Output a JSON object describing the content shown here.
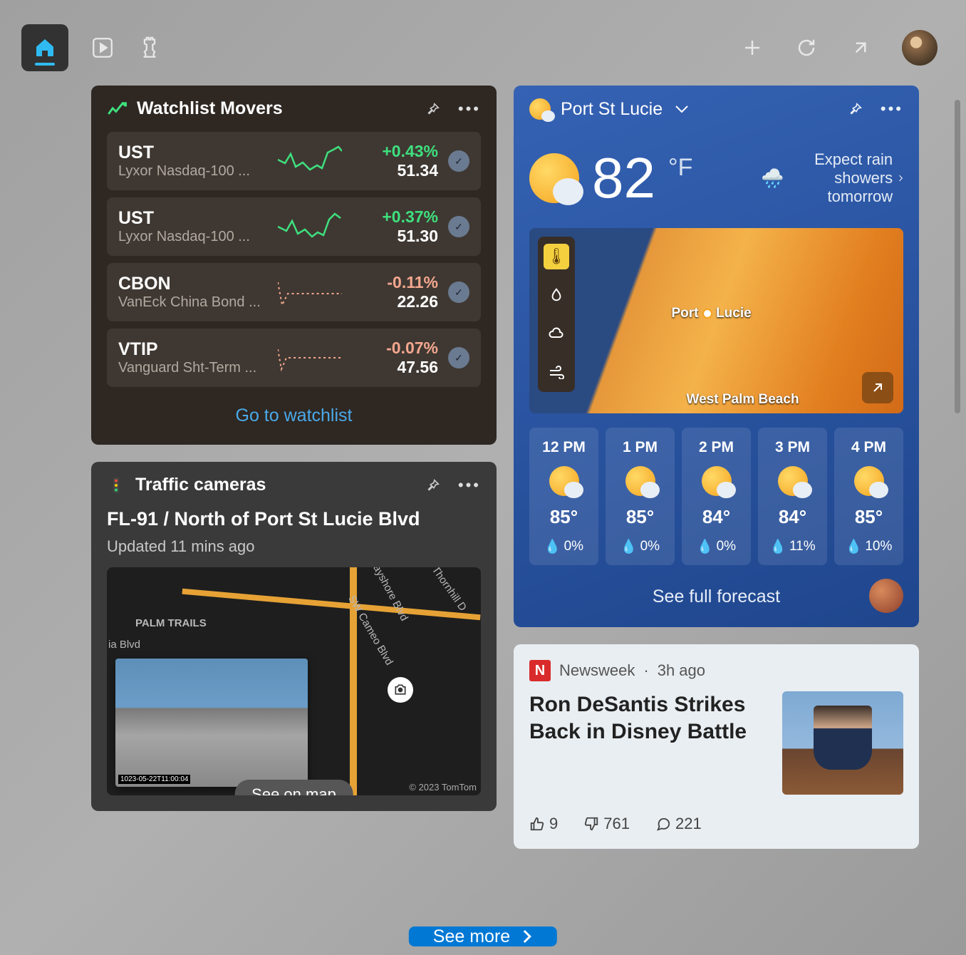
{
  "toolbar": {
    "home_icon": "home-icon",
    "play_icon": "play-icon",
    "chess_icon": "games-icon",
    "add_icon": "add-icon",
    "refresh_icon": "refresh-icon",
    "expand_icon": "expand-icon"
  },
  "watchlist": {
    "title": "Watchlist Movers",
    "footer": "Go to watchlist",
    "stocks": [
      {
        "ticker": "UST",
        "name": "Lyxor Nasdaq-100 ...",
        "change": "+0.43%",
        "price": "51.34",
        "dir": "pos"
      },
      {
        "ticker": "UST",
        "name": "Lyxor Nasdaq-100 ...",
        "change": "+0.37%",
        "price": "51.30",
        "dir": "pos"
      },
      {
        "ticker": "CBON",
        "name": "VanEck China Bond ...",
        "change": "-0.11%",
        "price": "22.26",
        "dir": "neg"
      },
      {
        "ticker": "VTIP",
        "name": "Vanguard Sht-Term ...",
        "change": "-0.07%",
        "price": "47.56",
        "dir": "neg"
      }
    ]
  },
  "traffic": {
    "title": "Traffic cameras",
    "camera_title": "FL-91 / North of Port St Lucie Blvd",
    "updated": "Updated 11 mins ago",
    "see_on_map": "See on map",
    "map_label1": "PALM TRAILS",
    "map_label2": "ia Blvd",
    "map_road1": "NW Bayshore Blvd",
    "map_road2": "SW Cameo Blvd",
    "map_road3": "SW Thornhill D",
    "copyright": "© 2023 TomTom",
    "thumb_ts": "1023-05-22T11:00:04"
  },
  "weather": {
    "location": "Port St Lucie",
    "temp": "82",
    "unit": "°F",
    "forecast_msg": "Expect rain showers tomorrow",
    "map_city1": "Port St Lucie",
    "map_tag1": "Port",
    "map_tag2": "Lucie",
    "map_city2": "West Palm Beach",
    "see_full": "See full forecast",
    "hourly": [
      {
        "time": "12 PM",
        "temp": "85°",
        "precip": "0%"
      },
      {
        "time": "1 PM",
        "temp": "85°",
        "precip": "0%"
      },
      {
        "time": "2 PM",
        "temp": "84°",
        "precip": "0%"
      },
      {
        "time": "3 PM",
        "temp": "84°",
        "precip": "11%"
      },
      {
        "time": "4 PM",
        "temp": "85°",
        "precip": "10%"
      }
    ]
  },
  "news": {
    "source": "Newsweek",
    "time": "3h ago",
    "headline": "Ron DeSantis Strikes Back in Disney Battle",
    "dislikes": "761",
    "comments": "221",
    "likes_partial": "9"
  },
  "see_more": "See more"
}
